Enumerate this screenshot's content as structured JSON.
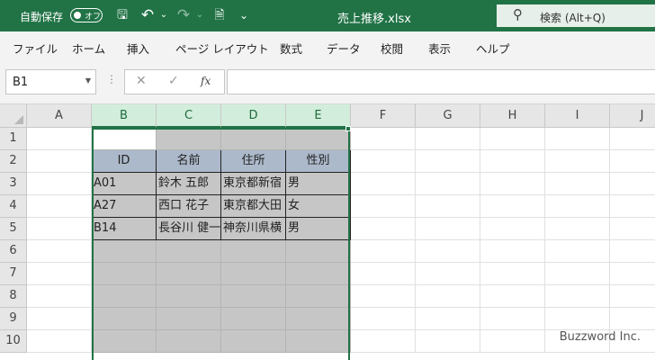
{
  "titlebar": {
    "autosave_label": "自動保存",
    "autosave_toggle": "オフ",
    "filename": "売上推移.xlsx",
    "search_placeholder": "検索 (Alt+Q)",
    "icons": [
      "save-icon",
      "undo-icon",
      "redo-icon",
      "form-icon",
      "customize-icon",
      "search-icon"
    ],
    "glyphs": {
      "save": "🖫",
      "undo": "↶",
      "redo": "↷",
      "form": "🗎",
      "customize": "⌄",
      "search": "⚲",
      "dropdown": "⌄"
    }
  },
  "menu": [
    "ファイル",
    "ホーム",
    "挿入",
    "ページ レイアウト",
    "数式",
    "データ",
    "校閲",
    "表示",
    "ヘルプ"
  ],
  "formula_bar": {
    "name_box": "B1",
    "cancel": "✕",
    "enter": "✓",
    "fx": "fx",
    "content": ""
  },
  "columns": [
    "A",
    "B",
    "C",
    "D",
    "E",
    "F",
    "G",
    "H",
    "I",
    "J"
  ],
  "rows": [
    "1",
    "2",
    "3",
    "4",
    "5",
    "6",
    "7",
    "8",
    "9",
    "10"
  ],
  "table": {
    "headers": [
      "ID",
      "名前",
      "住所",
      "性別"
    ],
    "rows": [
      [
        "A01",
        "鈴木 五郎",
        "東京都新宿",
        "男"
      ],
      [
        "A27",
        "西口 花子",
        "東京都大田",
        "女"
      ],
      [
        "B14",
        "長谷川 健一",
        "神奈川県横",
        "男"
      ]
    ]
  },
  "selection": {
    "active_cell": "B1",
    "range": "B1:E10"
  },
  "watermark": "Buzzword Inc.",
  "colors": {
    "accent": "#217346",
    "header_fill": "#acb9ca",
    "selection": "#c6c6c6"
  }
}
